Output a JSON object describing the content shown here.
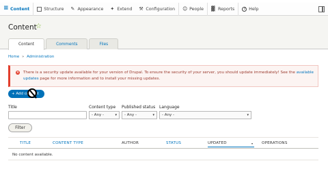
{
  "toolbar": {
    "items": [
      {
        "label": "Content",
        "icon": "menu-icon"
      },
      {
        "label": "Structure",
        "icon": "structure-icon"
      },
      {
        "label": "Appearance",
        "icon": "appearance-icon"
      },
      {
        "label": "Extend",
        "icon": "extend-icon"
      },
      {
        "label": "Configuration",
        "icon": "configuration-icon"
      },
      {
        "label": "People",
        "icon": "people-icon"
      },
      {
        "label": "Reports",
        "icon": "reports-icon"
      },
      {
        "label": "Help",
        "icon": "help-icon"
      }
    ]
  },
  "header": {
    "title": "Content",
    "star": "☆",
    "tabs": [
      {
        "label": "Content",
        "active": true
      },
      {
        "label": "Comments",
        "active": false
      },
      {
        "label": "Files",
        "active": false
      }
    ]
  },
  "breadcrumb": {
    "home": "Home",
    "separator": "»",
    "administration": "Administration"
  },
  "message": {
    "icon": "×",
    "text_before": "There is a security update available for your version of Drupal. To ensure the security of your server, you should update immediately! See the ",
    "link": "available updates",
    "text_after": " page for more information and to install your missing updates."
  },
  "actions": {
    "add_content": "+ Add content"
  },
  "filters": {
    "title_label": "Title",
    "title_value": "",
    "content_type_label": "Content type",
    "content_type_value": "- Any -",
    "published_label": "Published status",
    "published_value": "- Any -",
    "language_label": "Language",
    "language_value": "- Any -",
    "filter_button": "Filter",
    "caret": "▾"
  },
  "table": {
    "headers": {
      "title": "TITLE",
      "content_type": "CONTENT TYPE",
      "author": "AUTHOR",
      "status": "STATUS",
      "updated": "UPDATED",
      "operations": "OPERATIONS"
    },
    "sort_indicator": "▾",
    "empty": "No content available."
  },
  "colors": {
    "link": "#0074bd",
    "error": "#e23e2c",
    "primary_button": "#0071b8"
  }
}
